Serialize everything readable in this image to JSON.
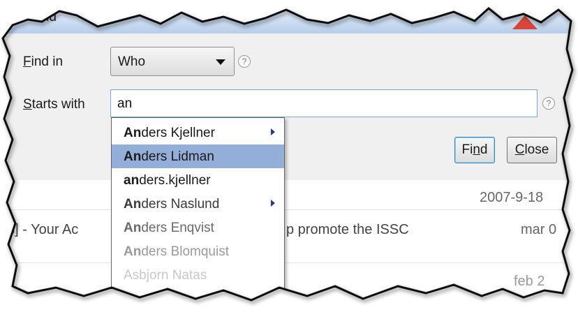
{
  "dialog": {
    "title": "Find",
    "find_in_label": "Find in",
    "find_in_mnemonic": "F",
    "find_in_rest": "ind in",
    "find_in_value": "Who",
    "starts_with_mnemonic": "S",
    "starts_with_rest": "tarts with",
    "starts_with_value": "an",
    "help_glyph": "?",
    "find_button_pre": "Fi",
    "find_button_mnemonic": "n",
    "find_button_post": "d",
    "close_button_mnemonic": "C",
    "close_button_rest": "lose"
  },
  "autocomplete": {
    "items": [
      {
        "bold": "An",
        "rest": "ders Kjellner",
        "has_submenu": true,
        "selected": false,
        "color": "#1a1a1a"
      },
      {
        "bold": "An",
        "rest": "ders Lidman",
        "has_submenu": false,
        "selected": true,
        "color": "#1a1a1a"
      },
      {
        "bold": "an",
        "rest": "ders.kjellner",
        "has_submenu": false,
        "selected": false,
        "color": "#1a1a1a"
      },
      {
        "bold": "An",
        "rest": "ders Naslund",
        "has_submenu": true,
        "selected": false,
        "color": "#3a3a3a"
      },
      {
        "bold": "An",
        "rest": "ders Enqvist",
        "has_submenu": false,
        "selected": false,
        "color": "#6a6a6a"
      },
      {
        "bold": "An",
        "rest": "ders Blomquist",
        "has_submenu": false,
        "selected": false,
        "color": "#9a9a9a"
      },
      {
        "bold": "",
        "rest": "Asbjorn Natas",
        "has_submenu": false,
        "selected": false,
        "color": "#c8c8c8"
      }
    ]
  },
  "background": {
    "row1_date": "2007-9-18",
    "row2_left": "es] - Your Ac",
    "row2_mid": "p promote the ISSC",
    "row2_date": "mar 0",
    "row3_date": "feb 2"
  },
  "colors": {
    "accent": "#3c7fb1",
    "selection": "#93aed8"
  }
}
